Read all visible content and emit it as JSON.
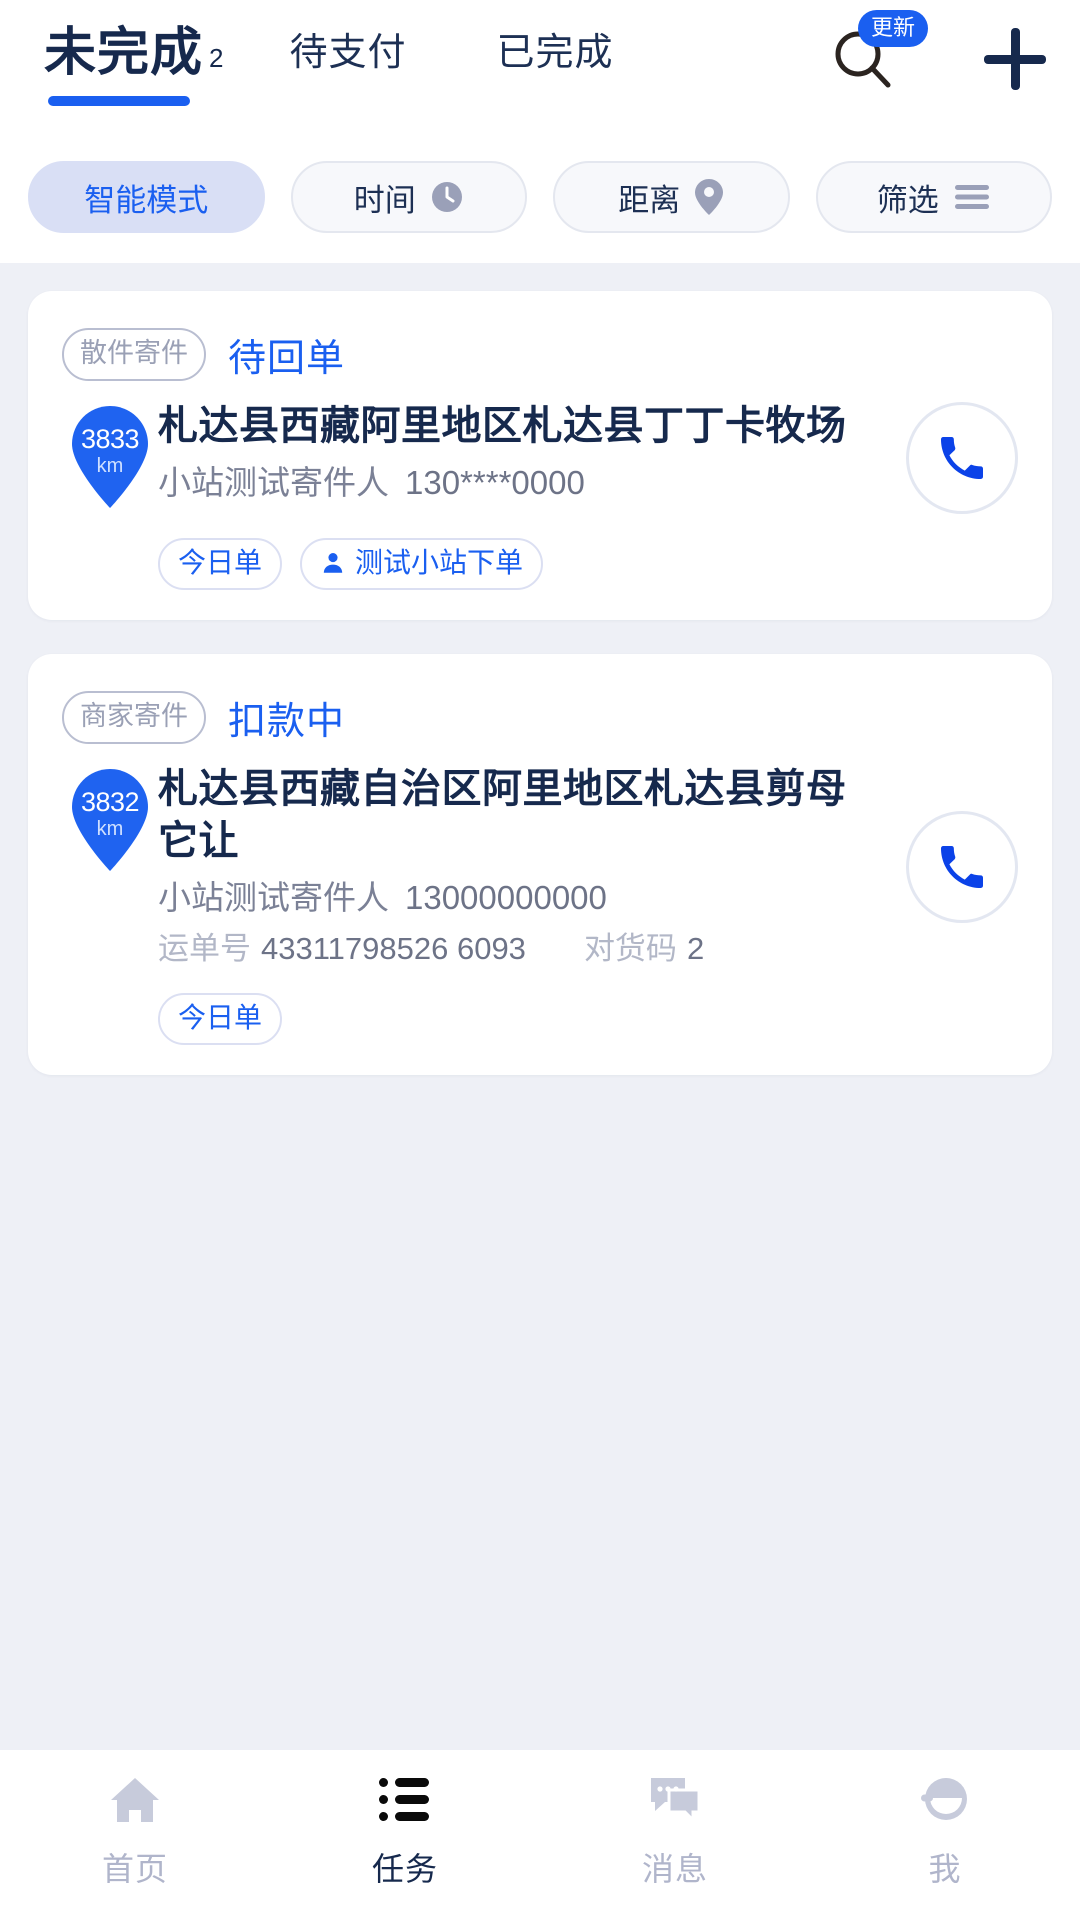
{
  "header": {
    "tabs": [
      {
        "label": "未完成",
        "count": "2",
        "active": true
      },
      {
        "label": "待支付",
        "count": "",
        "active": false
      },
      {
        "label": "已完成",
        "count": "",
        "active": false
      }
    ],
    "search_icon": "search-icon",
    "search_badge": "更新",
    "add_icon": "plus-icon"
  },
  "filters": [
    {
      "label": "智能模式",
      "icon": "",
      "selected": true
    },
    {
      "label": "时间",
      "icon": "clock-icon",
      "selected": false
    },
    {
      "label": "距离",
      "icon": "location-pin-icon",
      "selected": false
    },
    {
      "label": "筛选",
      "icon": "filter-lines-icon",
      "selected": false
    }
  ],
  "orders": [
    {
      "type_tag": "散件寄件",
      "status": "待回单",
      "distance": "3833",
      "distance_unit": "km",
      "address": "札达县西藏阿里地区札达县丁丁卡牧场",
      "sender_name": "小站测试寄件人",
      "sender_phone": "130****0000",
      "waybill_label": "",
      "waybill_no": "",
      "pickup_label": "",
      "pickup_code": "",
      "tags": [
        {
          "label": "今日单",
          "icon": ""
        },
        {
          "label": "测试小站下单",
          "icon": "person-icon"
        }
      ],
      "call_icon": "phone-icon"
    },
    {
      "type_tag": "商家寄件",
      "status": "扣款中",
      "distance": "3832",
      "distance_unit": "km",
      "address": "札达县西藏自治区阿里地区札达县剪母它让",
      "sender_name": "小站测试寄件人",
      "sender_phone": "13000000000",
      "waybill_label": "运单号",
      "waybill_no": "43311798526 6093",
      "pickup_label": "对货码",
      "pickup_code": "2",
      "tags": [
        {
          "label": "今日单",
          "icon": ""
        }
      ],
      "call_icon": "phone-icon"
    }
  ],
  "bottom_nav": [
    {
      "label": "首页",
      "icon": "home-icon",
      "active": false
    },
    {
      "label": "任务",
      "icon": "list-icon",
      "active": true
    },
    {
      "label": "消息",
      "icon": "chat-icon",
      "active": false
    },
    {
      "label": "我",
      "icon": "profile-icon",
      "active": false
    }
  ],
  "colors": {
    "accent_blue": "#1a5ff0",
    "dark_navy": "#16294d",
    "muted_gray": "#9aa0b5",
    "page_bg": "#eef0f6"
  }
}
